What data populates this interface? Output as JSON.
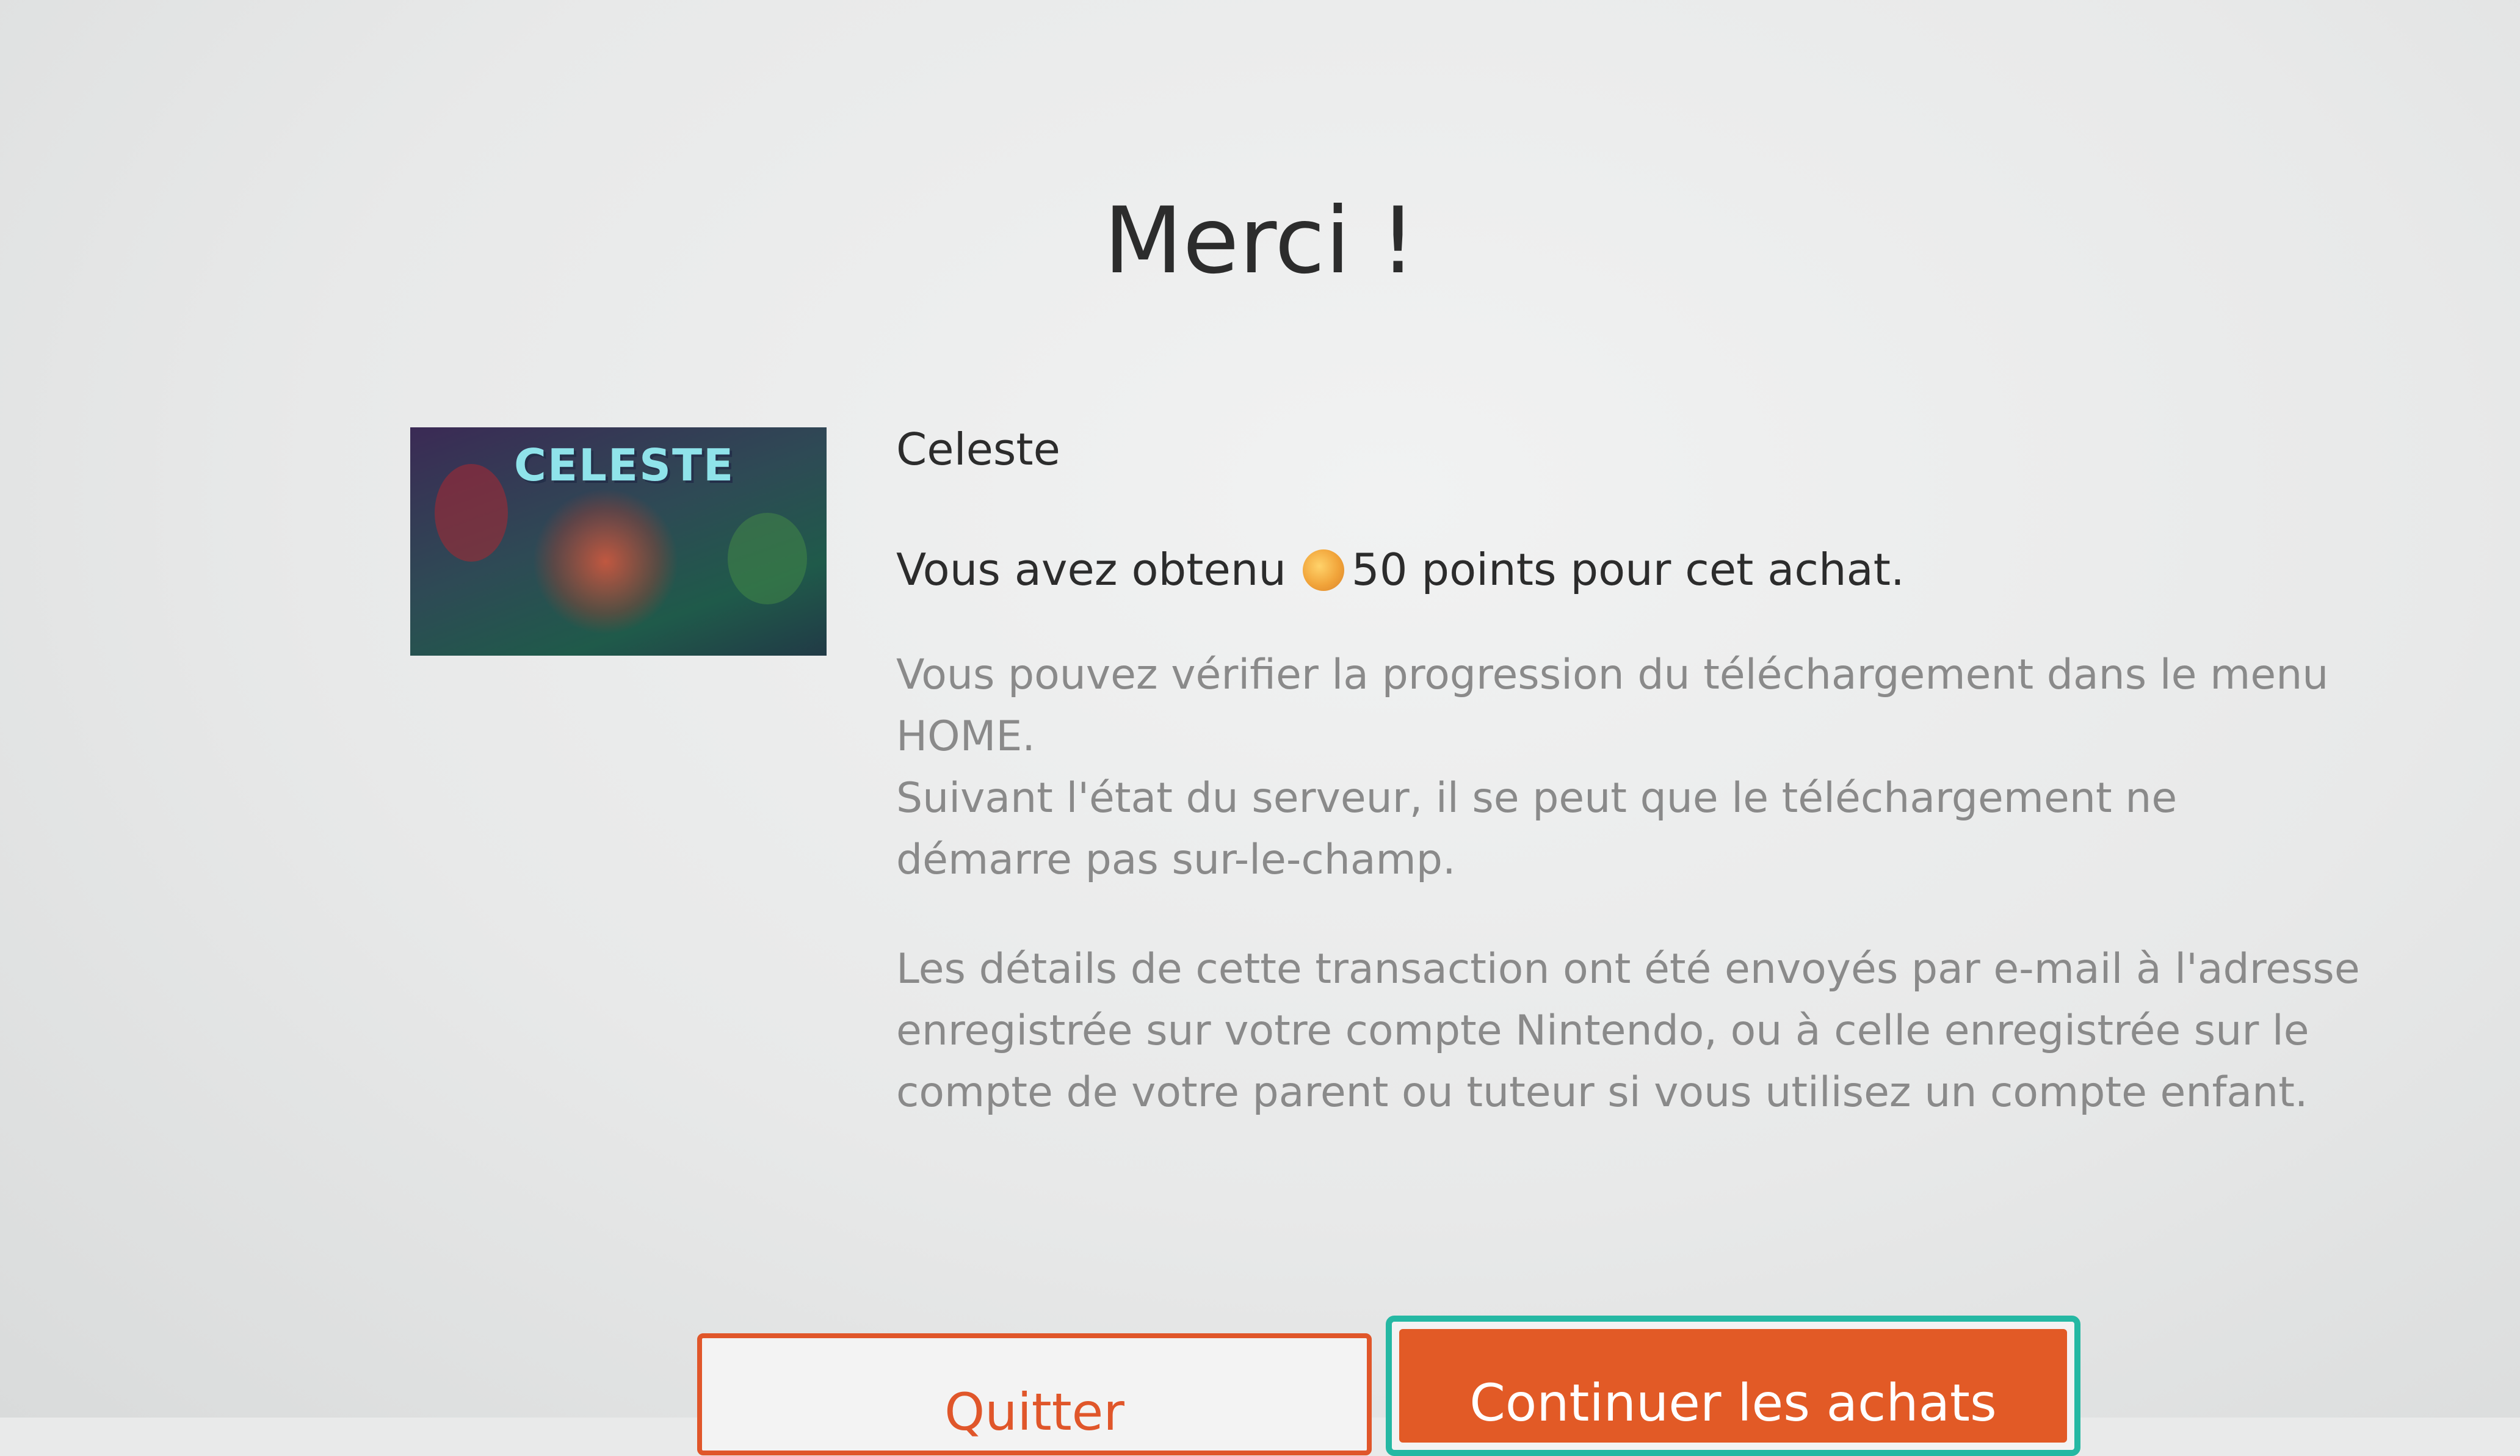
{
  "dialog": {
    "title": "Merci !",
    "game": {
      "name": "Celeste",
      "thumbnail_logo": "CELESTE"
    },
    "points_message": {
      "prefix": "Vous avez obtenu",
      "icon": "gold-points-coin-icon",
      "suffix": "50 points pour cet achat."
    },
    "info_download": "Vous pouvez vérifier la progression du téléchargement dans le menu HOME.\nSuivant l'état du serveur, il se peut que le téléchargement ne démarre pas sur-le-champ.",
    "info_email": "Les détails de cette transaction ont été envoyés par e-mail à l'adresse enregistrée sur votre compte Nintendo, ou à celle enregistrée sur le compte de votre parent ou tuteur si vous utilisez un compte enfant."
  },
  "buttons": {
    "quit_label": "Quitter",
    "continue_label": "Continuer les achats"
  },
  "colors": {
    "accent": "#e25a26",
    "focus_border": "#25b8a3",
    "text_primary": "#2c2c2c",
    "text_secondary": "#8a8a8a",
    "background": "#ebebeb"
  }
}
